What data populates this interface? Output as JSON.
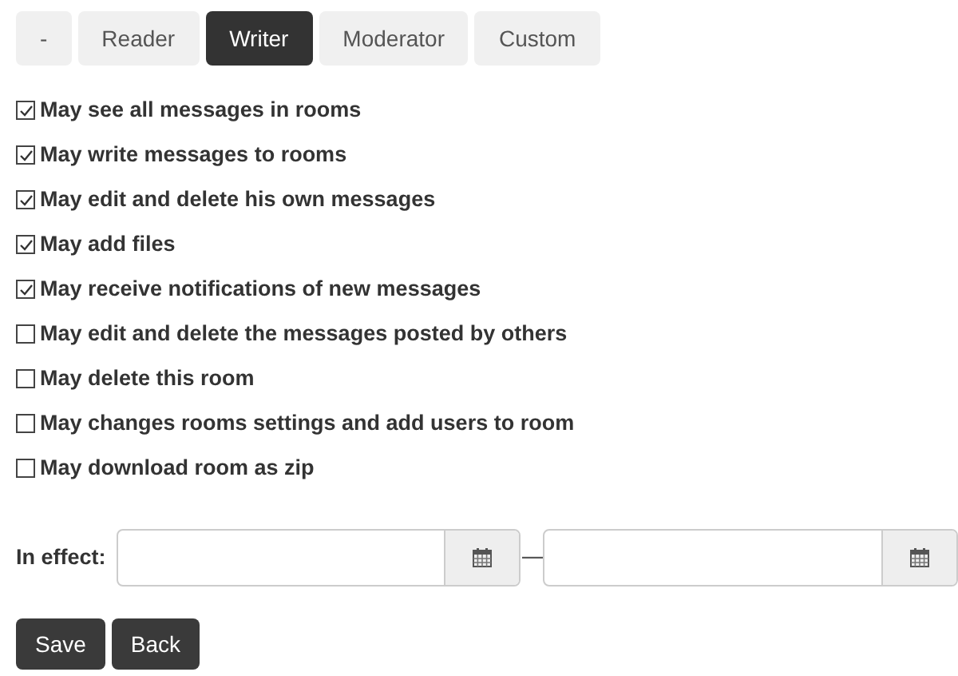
{
  "role_tabs": [
    {
      "label": "-",
      "selected": false
    },
    {
      "label": "Reader",
      "selected": false
    },
    {
      "label": "Writer",
      "selected": true
    },
    {
      "label": "Moderator",
      "selected": false
    },
    {
      "label": "Custom",
      "selected": false
    }
  ],
  "permissions": [
    {
      "label": "May see all messages in rooms",
      "checked": true
    },
    {
      "label": "May write messages to rooms",
      "checked": true
    },
    {
      "label": "May edit and delete his own messages",
      "checked": true
    },
    {
      "label": "May add files",
      "checked": true
    },
    {
      "label": "May receive notifications of new messages",
      "checked": true
    },
    {
      "label": "May edit and delete the messages posted by others",
      "checked": false
    },
    {
      "label": "May delete this room",
      "checked": false
    },
    {
      "label": "May changes rooms settings and add users to room",
      "checked": false
    },
    {
      "label": "May download room as zip",
      "checked": false
    }
  ],
  "in_effect": {
    "label": "In effect:",
    "separator": "—"
  },
  "buttons": [
    "Save",
    "Back"
  ]
}
